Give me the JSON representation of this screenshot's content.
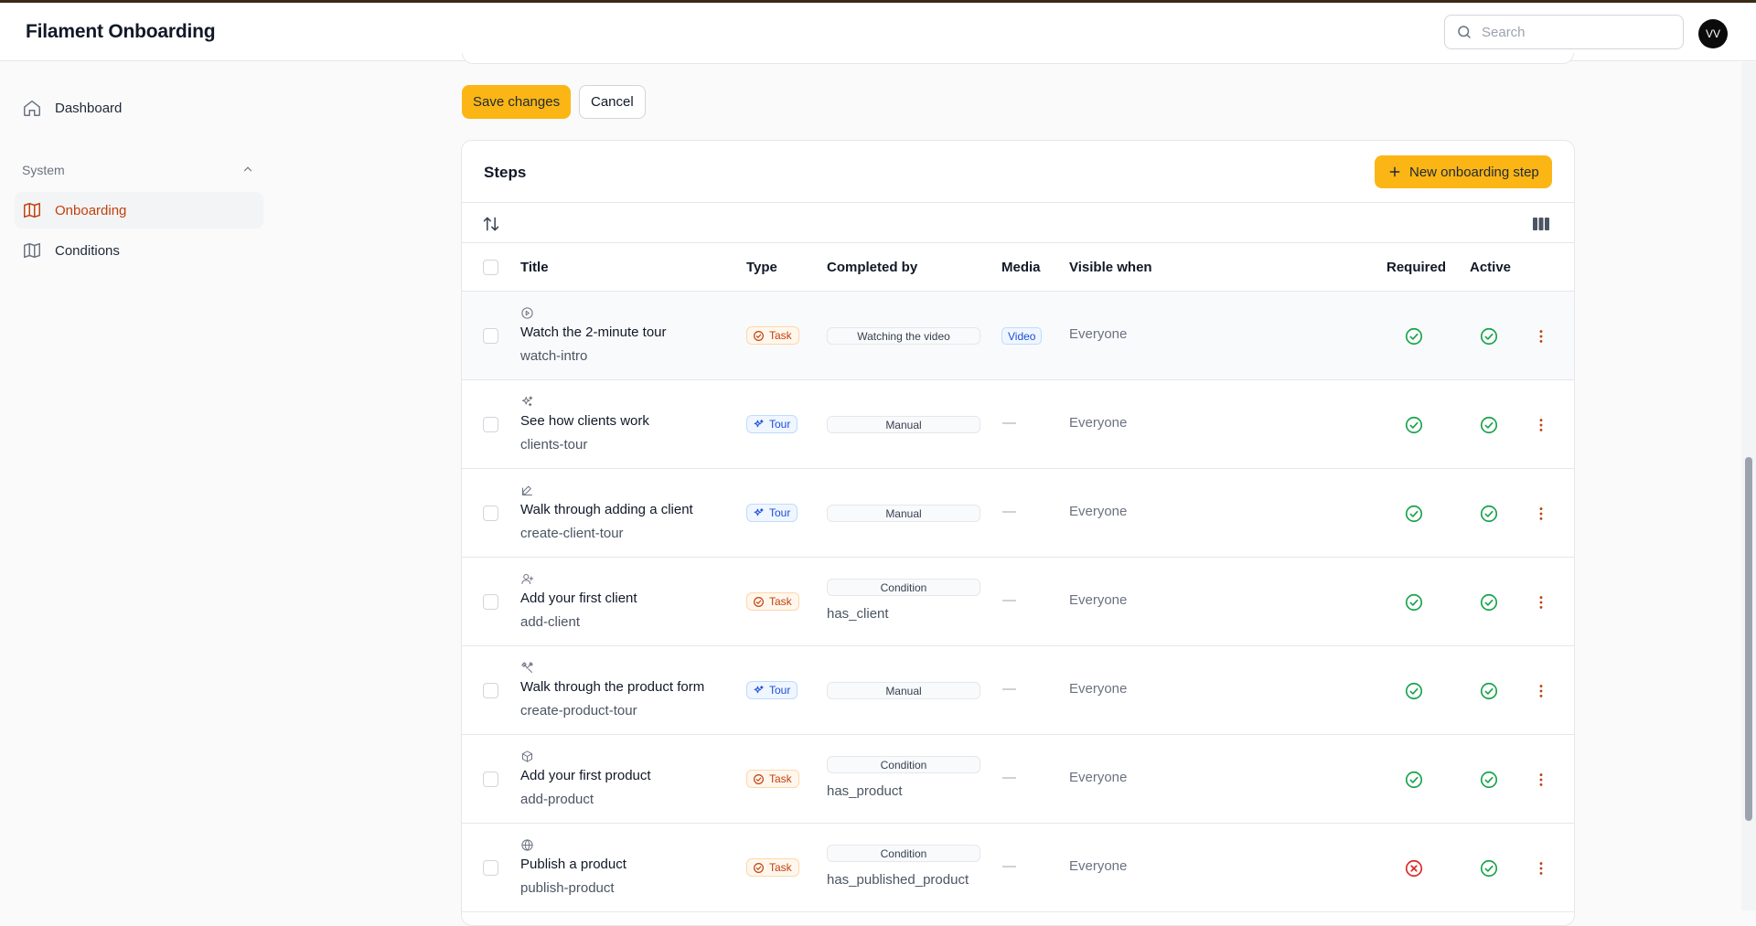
{
  "app": {
    "title": "Filament Onboarding"
  },
  "search": {
    "placeholder": "Search"
  },
  "user": {
    "initials": "VV"
  },
  "sidebar": {
    "dashboard_label": "Dashboard",
    "group_label": "System",
    "items": [
      {
        "label": "Onboarding",
        "active": true
      },
      {
        "label": "Conditions",
        "active": false
      }
    ]
  },
  "form": {
    "save_label": "Save changes",
    "cancel_label": "Cancel"
  },
  "steps": {
    "title": "Steps",
    "new_label": "New onboarding step",
    "columns": {
      "title": "Title",
      "type": "Type",
      "completed_by": "Completed by",
      "media": "Media",
      "visible_when": "Visible when",
      "required": "Required",
      "active": "Active"
    },
    "rows": [
      {
        "icon": "play-circle-icon",
        "title": "Watch the 2-minute tour",
        "key": "watch-intro",
        "type": "Task",
        "completed_by": "Watching the video",
        "condition_key": "",
        "media": "Video",
        "visible_when": "Everyone",
        "required": true,
        "active": true
      },
      {
        "icon": "sparkles-icon",
        "title": "See how clients work",
        "key": "clients-tour",
        "type": "Tour",
        "completed_by": "Manual",
        "condition_key": "",
        "media": "—",
        "visible_when": "Everyone",
        "required": true,
        "active": true
      },
      {
        "icon": "pencil-square-icon",
        "title": "Walk through adding a client",
        "key": "create-client-tour",
        "type": "Tour",
        "completed_by": "Manual",
        "condition_key": "",
        "media": "—",
        "visible_when": "Everyone",
        "required": true,
        "active": true
      },
      {
        "icon": "user-plus-icon",
        "title": "Add your first client",
        "key": "add-client",
        "type": "Task",
        "completed_by": "Condition",
        "condition_key": "has_client",
        "media": "—",
        "visible_when": "Everyone",
        "required": true,
        "active": true
      },
      {
        "icon": "wrench-screwdriver-icon",
        "title": "Walk through the product form",
        "key": "create-product-tour",
        "type": "Tour",
        "completed_by": "Manual",
        "condition_key": "",
        "media": "—",
        "visible_when": "Everyone",
        "required": true,
        "active": true
      },
      {
        "icon": "cube-icon",
        "title": "Add your first product",
        "key": "add-product",
        "type": "Task",
        "completed_by": "Condition",
        "condition_key": "has_product",
        "media": "—",
        "visible_when": "Everyone",
        "required": true,
        "active": true
      },
      {
        "icon": "globe-icon",
        "title": "Publish a product",
        "key": "publish-product",
        "type": "Task",
        "completed_by": "Condition",
        "condition_key": "has_published_product",
        "media": "—",
        "visible_when": "Everyone",
        "required": false,
        "active": true
      }
    ]
  },
  "colors": {
    "accent": "#fbb615",
    "active_nav": "#c2410c",
    "success": "#16a34a",
    "danger": "#dc2626",
    "task_badge": "#c2410c",
    "tour_badge": "#1d4ed8"
  }
}
